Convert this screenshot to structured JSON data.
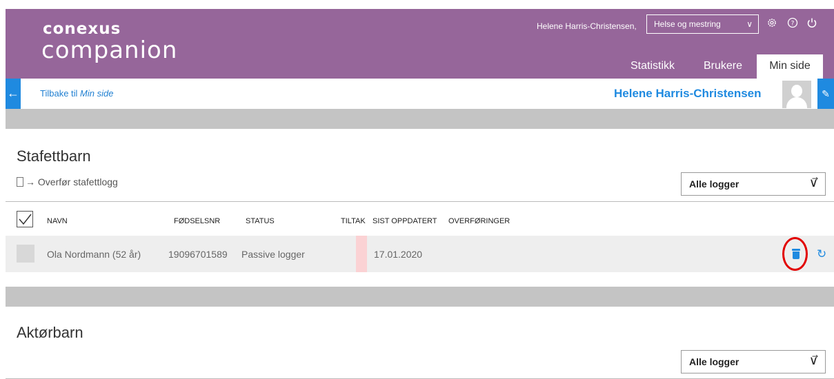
{
  "header": {
    "logo_top": "conexus",
    "logo_bottom": "companion",
    "user_name": "Helene Harris-Christensen,",
    "org_select": "Helse og mestring",
    "icons": [
      "gear-icon",
      "help-icon",
      "power-icon"
    ],
    "tabs": [
      {
        "label": "Statistikk",
        "active": false
      },
      {
        "label": "Brukere",
        "active": false
      },
      {
        "label": "Min side",
        "active": true
      }
    ]
  },
  "backbar": {
    "back_prefix": "Tilbake til ",
    "back_target": "Min side",
    "profile_name": "Helene Harris-Christensen"
  },
  "stafett": {
    "title": "Stafettbarn",
    "transfer_label": "Overfør stafettlogg",
    "filter": "Alle logger",
    "columns": [
      "NAVN",
      "FØDSELSNR",
      "STATUS",
      "TILTAK",
      "SIST OPPDATERT",
      "OVERFØRINGER"
    ],
    "rows": [
      {
        "name": "Ola Nordmann (52 år)",
        "ssn": "19096701589",
        "status": "Passive logger",
        "updated": "17.01.2020"
      }
    ]
  },
  "aktor": {
    "title": "Aktørbarn",
    "filter": "Alle logger"
  },
  "colors": {
    "brand": "#96669a",
    "accent": "#1f8ae0",
    "highlight": "#e20000"
  }
}
